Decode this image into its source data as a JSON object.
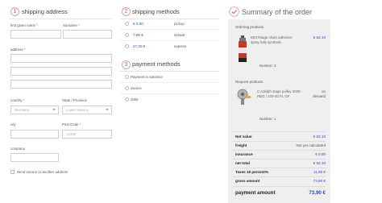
{
  "shipping_address": {
    "step": "1",
    "title": "shipping address",
    "first_name_label": "first given name",
    "surname_label": "Surname",
    "address_label": "address",
    "required_mark": "*",
    "country_label": "country",
    "state_label": "State / Province",
    "country_value": "Germany",
    "state_value": "Lower Saxony",
    "city_label": "city",
    "post_code_label": "Post Code",
    "post_code_placeholder": "12345",
    "company_label": "company",
    "send_invoice_label": "Send invoice to another address"
  },
  "shipping_methods": {
    "step": "2",
    "title": "shipping methods",
    "options": [
      {
        "price": "€ 0.00",
        "name": "pickup"
      },
      {
        "price": "7,90 €",
        "name": "default"
      },
      {
        "price": "27,00 €",
        "name": "express"
      }
    ]
  },
  "payment_methods": {
    "step": "3",
    "title": "payment methods",
    "options": [
      {
        "name": "Payment in advance"
      },
      {
        "name": "invoice"
      },
      {
        "name": "debit"
      }
    ]
  },
  "summary": {
    "title": "Summary of the order",
    "ordering_products_label": "Ordering products",
    "product1": {
      "name_line1": "IBISTstage chain adhesive",
      "name_line2": "spray fully synthetic",
      "price": "€ 62.10",
      "number_label": "Number: 3"
    },
    "request_products_label": "Request products",
    "product2": {
      "name_line1": "C Adolph stage pulley 2000-",
      "name_line2": "RBG / 100-40 FL GF",
      "price_line1": "on",
      "price_line2": "demand",
      "number_label": "Number: 1"
    },
    "totals": [
      {
        "label": "Net value",
        "value": "€ 62.10"
      },
      {
        "label": "freight",
        "value": "Not yet calculated"
      },
      {
        "label": "insurance",
        "value": "€ 0.00"
      },
      {
        "label": "net total",
        "value": "€ 62.10"
      },
      {
        "label": "Taxes 19 percent%",
        "value": "11,80 €"
      },
      {
        "label": "gross amount",
        "value": "73,90 €"
      }
    ],
    "payment_amount_label": "payment amount",
    "payment_amount_value": "73,90 €"
  },
  "colors": {
    "accent": "#d05a5a",
    "price_blue": "#2a4db0",
    "panel_bg": "#efefef"
  }
}
